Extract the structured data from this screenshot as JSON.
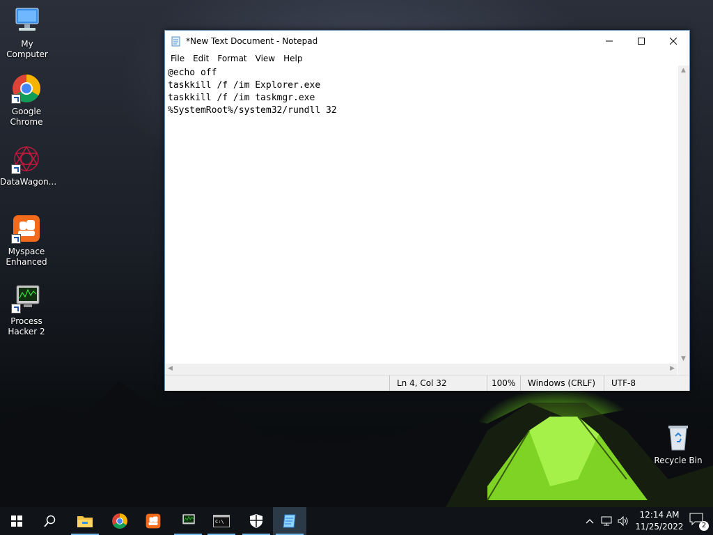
{
  "desktop": {
    "icons": [
      {
        "label": "My Computer"
      },
      {
        "label": "Google Chrome"
      },
      {
        "label": "DataWagon..."
      },
      {
        "label": "Myspace Enhanced"
      },
      {
        "label": "Process Hacker 2"
      },
      {
        "label": "Recycle Bin"
      }
    ]
  },
  "notepad": {
    "title": "*New Text Document - Notepad",
    "menu": [
      "File",
      "Edit",
      "Format",
      "View",
      "Help"
    ],
    "content": "@echo off\ntaskkill /f /im Explorer.exe\ntaskkill /f /im taskmgr.exe\n%SystemRoot%/system32/rundll 32",
    "status": {
      "position": "Ln 4, Col 32",
      "zoom": "100%",
      "line_ending": "Windows (CRLF)",
      "encoding": "UTF-8"
    }
  },
  "taskbar": {
    "clock_time": "12:14 AM",
    "clock_date": "11/25/2022",
    "notification_count": "2",
    "items": [
      "start-icon",
      "search-icon",
      "file-explorer-icon",
      "chrome-icon",
      "myspace-icon",
      "process-hacker-icon",
      "terminal-icon",
      "security-icon",
      "notepad-icon"
    ]
  },
  "colors": {
    "taskbar": "#101418",
    "accent": "#76b9ed",
    "tent_green": "#9cf23a"
  }
}
